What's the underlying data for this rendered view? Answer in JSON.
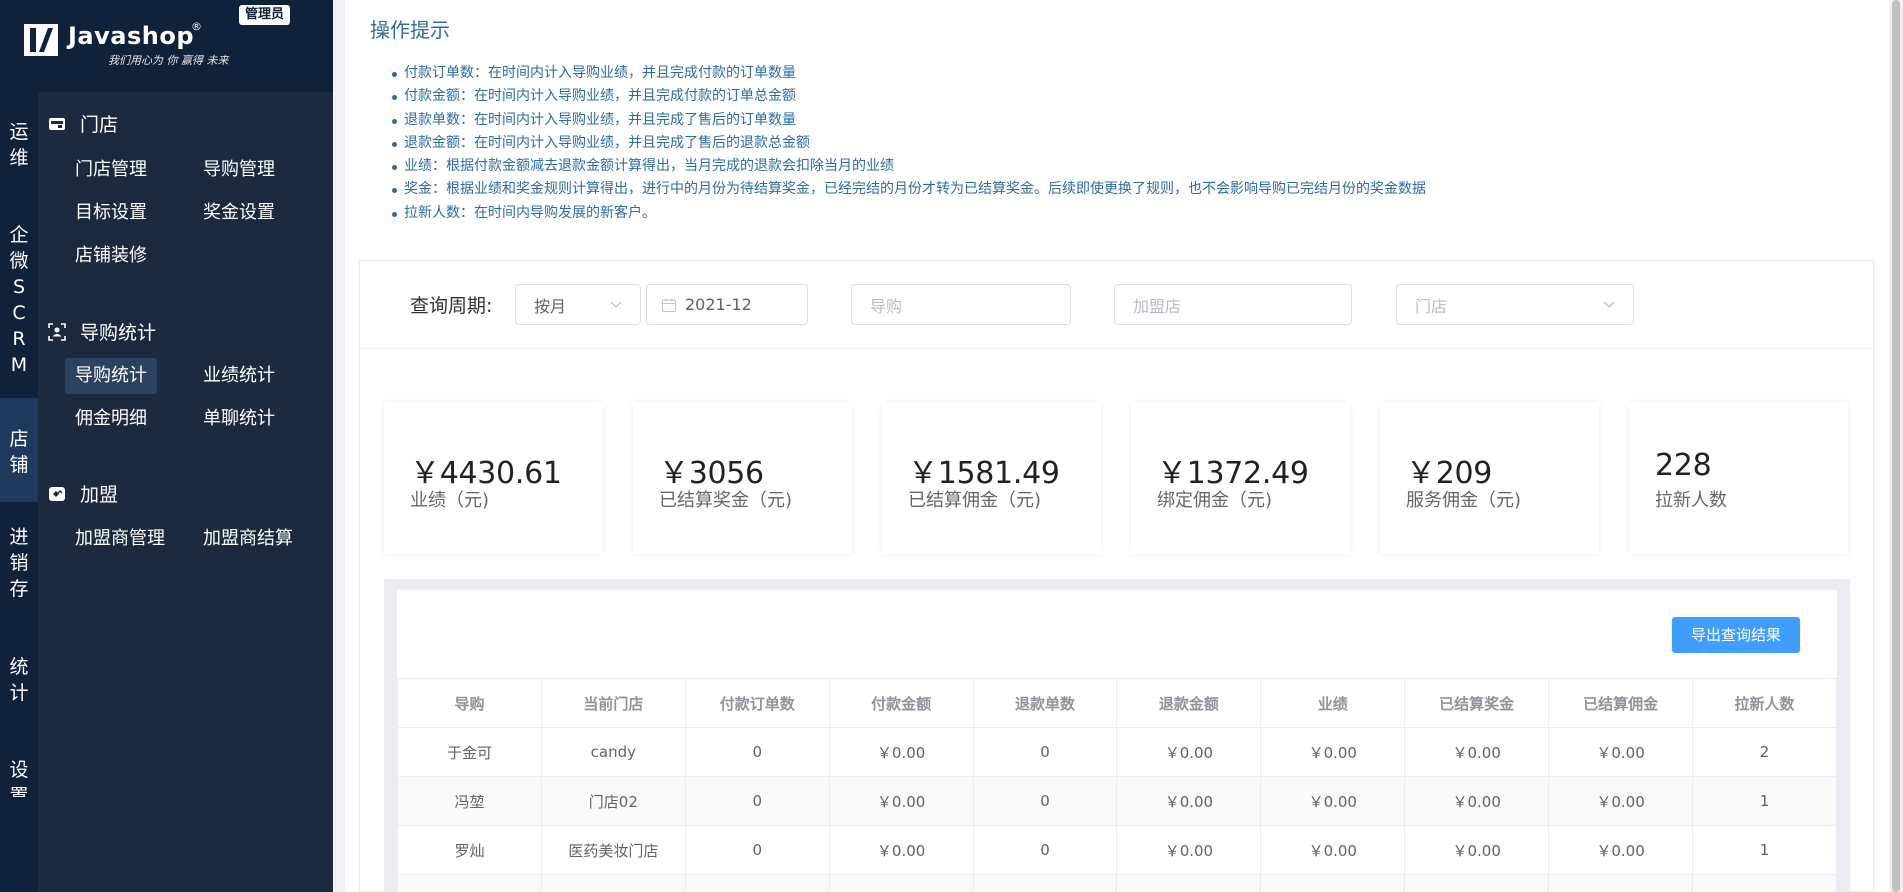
{
  "brand": {
    "name": "Javashop",
    "registered": "®",
    "slogan": "我们用心为 你 赢得 未来",
    "role_badge": "管理员"
  },
  "rail": [
    {
      "label": "运维",
      "chars": [
        "运",
        "维"
      ]
    },
    {
      "label": "企微SCRM",
      "chars": [
        "企",
        "微",
        "S",
        "C",
        "R",
        "M"
      ]
    },
    {
      "label": "店铺",
      "chars": [
        "店",
        "铺"
      ],
      "active": true
    },
    {
      "label": "进销存",
      "chars": [
        "进",
        "销",
        "存"
      ]
    },
    {
      "label": "统计",
      "chars": [
        "统",
        "计"
      ]
    },
    {
      "label": "设置",
      "chars": [
        "设",
        "置"
      ]
    }
  ],
  "menu": {
    "groups": [
      {
        "title": "门店",
        "icon": "store-icon",
        "items": [
          "门店管理",
          "导购管理",
          "目标设置",
          "奖金设置",
          "店铺装修"
        ]
      },
      {
        "title": "导购统计",
        "icon": "user-stat-icon",
        "items": [
          "导购统计",
          "业绩统计",
          "佣金明细",
          "单聊统计"
        ],
        "active_item": "导购统计"
      },
      {
        "title": "加盟",
        "icon": "franchise-icon",
        "items": [
          "加盟商管理",
          "加盟商结算"
        ]
      }
    ]
  },
  "tips": {
    "title": "操作提示",
    "items": [
      "付款订单数：在时间内计入导购业绩，并且完成付款的订单数量",
      "付款金额：在时间内计入导购业绩，并且完成付款的订单总金额",
      "退款单数：在时间内计入导购业绩，并且完成了售后的订单数量",
      "退款金额：在时间内计入导购业绩，并且完成了售后的退款总金额",
      "业绩：根据付款金额减去退款金额计算得出，当月完成的退款会扣除当月的业绩",
      "奖金：根据业绩和奖金规则计算得出，进行中的月份为待结算奖金，已经完结的月份才转为已结算奖金。后续即使更换了规则，也不会影响导购已完结月份的奖金数据",
      "拉新人数：在时间内导购发展的新客户。"
    ]
  },
  "filters": {
    "label": "查询周期:",
    "period_select": "按月",
    "date_value": "2021-12",
    "guide_placeholder": "导购",
    "franchise_placeholder": "加盟店",
    "store_placeholder": "门店"
  },
  "stats": [
    {
      "value": "￥4430.61",
      "label": "业绩（元)"
    },
    {
      "value": "￥3056",
      "label": "已结算奖金（元)"
    },
    {
      "value": "￥1581.49",
      "label": "已结算佣金（元)"
    },
    {
      "value": "￥1372.49",
      "label": "绑定佣金（元)"
    },
    {
      "value": "￥209",
      "label": "服务佣金（元)"
    },
    {
      "value": "228",
      "label": "拉新人数"
    }
  ],
  "export_button": "导出查询结果",
  "table": {
    "columns": [
      "导购",
      "当前门店",
      "付款订单数",
      "付款金额",
      "退款单数",
      "退款金额",
      "业绩",
      "已结算奖金",
      "已结算佣金",
      "拉新人数"
    ],
    "rows": [
      [
        "于金可",
        "candy",
        "0",
        "￥0.00",
        "0",
        "￥0.00",
        "￥0.00",
        "￥0.00",
        "￥0.00",
        "2"
      ],
      [
        "冯堃",
        "门店02",
        "0",
        "￥0.00",
        "0",
        "￥0.00",
        "￥0.00",
        "￥0.00",
        "￥0.00",
        "1"
      ],
      [
        "罗灿",
        "医药美妆门店",
        "0",
        "￥0.00",
        "0",
        "￥0.00",
        "￥0.00",
        "￥0.00",
        "￥0.00",
        "1"
      ]
    ]
  }
}
